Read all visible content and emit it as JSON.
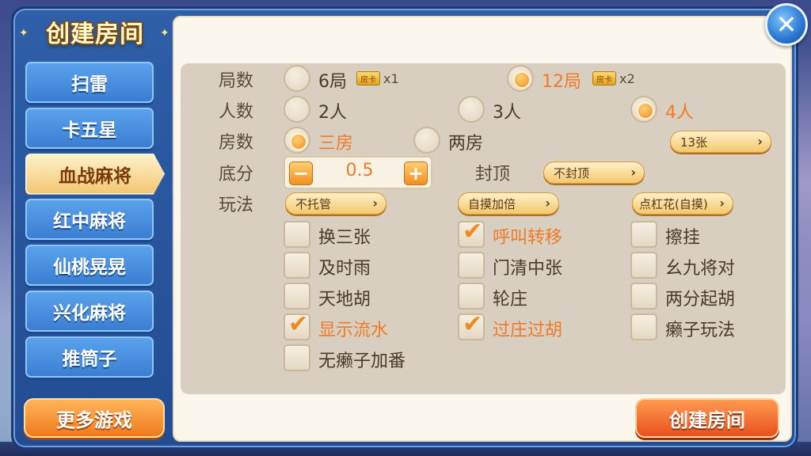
{
  "title": "创建房间",
  "close_icon": "close-icon",
  "game_tabs": [
    {
      "label": "扫雷",
      "active": false
    },
    {
      "label": "卡五星",
      "active": false
    },
    {
      "label": "血战麻将",
      "active": true
    },
    {
      "label": "红中麻将",
      "active": false
    },
    {
      "label": "仙桃晃晃",
      "active": false
    },
    {
      "label": "兴化麻将",
      "active": false
    },
    {
      "label": "推筒子",
      "active": false
    }
  ],
  "more_games_label": "更多游戏",
  "create_button_label": "创建房间",
  "rounds": {
    "label": "局数",
    "options": [
      {
        "label": "6局",
        "card_icon": "房卡",
        "multiplier": "x1",
        "selected": false
      },
      {
        "label": "12局",
        "card_icon": "房卡",
        "multiplier": "x2",
        "selected": true
      }
    ]
  },
  "players": {
    "label": "人数",
    "options": [
      {
        "label": "2人",
        "selected": false
      },
      {
        "label": "3人",
        "selected": false
      },
      {
        "label": "4人",
        "selected": true
      }
    ]
  },
  "rooms": {
    "label": "房数",
    "options": [
      {
        "label": "三房",
        "selected": true
      },
      {
        "label": "两房",
        "selected": false
      }
    ],
    "tiles_dropdown": "13张"
  },
  "base_score": {
    "label": "底分",
    "value": "0.5",
    "minus": "−",
    "plus": "+",
    "cap_label": "封顶",
    "cap_dropdown": "不封顶"
  },
  "play_style": {
    "label": "玩法",
    "dropdowns": [
      "不托管",
      "自摸加倍",
      "点杠花(自摸)"
    ]
  },
  "rules": [
    {
      "label": "换三张",
      "checked": false
    },
    {
      "label": "呼叫转移",
      "checked": true
    },
    {
      "label": "擦挂",
      "checked": false
    },
    {
      "label": "及时雨",
      "checked": false
    },
    {
      "label": "门清中张",
      "checked": false
    },
    {
      "label": "幺九将对",
      "checked": false
    },
    {
      "label": "天地胡",
      "checked": false
    },
    {
      "label": "轮庄",
      "checked": false
    },
    {
      "label": "两分起胡",
      "checked": false
    },
    {
      "label": "显示流水",
      "checked": true
    },
    {
      "label": "过庄过胡",
      "checked": true
    },
    {
      "label": "癞子玩法",
      "checked": false
    },
    {
      "label": "无癞子加番",
      "checked": false
    }
  ],
  "check_glyph": "✔",
  "chevron_glyph": "›",
  "close_glyph": "✕",
  "colors": {
    "accent_orange": "#f07a28",
    "panel_blue": "#2e5fa8",
    "cream": "#fbf7ec"
  }
}
